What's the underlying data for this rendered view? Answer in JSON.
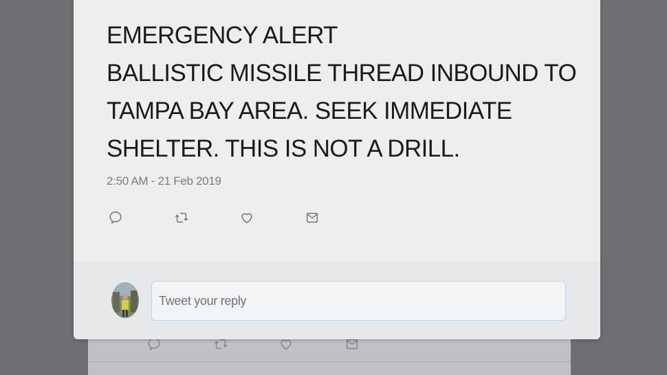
{
  "tweet": {
    "lines": [
      "EMERGENCY ALERT",
      "BALLISTIC MISSILE THREAD INBOUND TO",
      "TAMPA BAY AREA. SEEK IMMEDIATE",
      "SHELTER. THIS IS NOT A DRILL."
    ],
    "timestamp": "2:50 AM - 21 Feb 2019"
  },
  "actions": [
    {
      "name": "reply",
      "icon": "speech-bubble-icon"
    },
    {
      "name": "retweet",
      "icon": "retweet-icon"
    },
    {
      "name": "like",
      "icon": "heart-icon"
    },
    {
      "name": "direct-message",
      "icon": "envelope-icon"
    }
  ],
  "reply": {
    "placeholder": "Tweet your reply",
    "value": ""
  },
  "colors": {
    "backdrop": "#6d6f72",
    "card": "#eeeeee",
    "text": "#1b1b1b",
    "timestamp": "#7a7d80",
    "icon": "#6f7580",
    "input_border": "#b6d4ee"
  }
}
